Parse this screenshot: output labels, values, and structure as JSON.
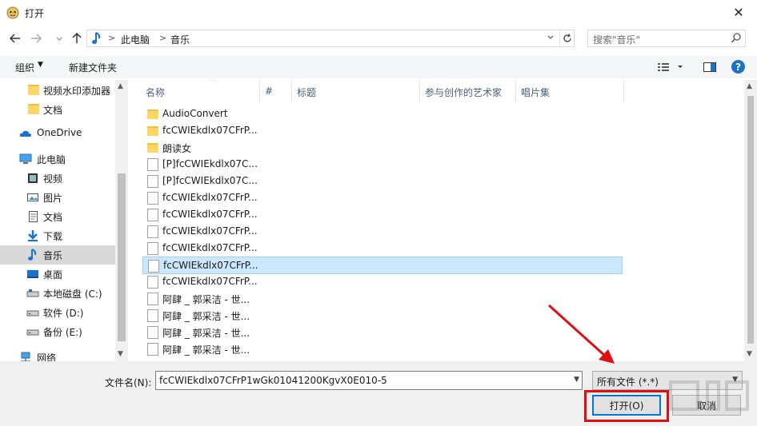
{
  "window": {
    "title": "打开",
    "close_symbol": "✕"
  },
  "address": {
    "crumbs": [
      "此电脑",
      "音乐"
    ],
    "separator": ">"
  },
  "search": {
    "placeholder": "搜索\"音乐\""
  },
  "toolbar": {
    "organize_label": "组织",
    "new_folder_label": "新建文件夹",
    "help_label": "?"
  },
  "nav": {
    "items": [
      {
        "label": "视频水印添加器",
        "icon": "folder-icon",
        "selected": false
      },
      {
        "label": "文档",
        "icon": "folder-icon",
        "selected": false
      },
      {
        "label": "OneDrive",
        "icon": "onedrive-icon",
        "selected": false
      },
      {
        "label": "此电脑",
        "icon": "computer-icon",
        "selected": false
      },
      {
        "label": "视频",
        "icon": "video-icon",
        "selected": false
      },
      {
        "label": "图片",
        "icon": "pictures-icon",
        "selected": false
      },
      {
        "label": "文档",
        "icon": "documents-icon",
        "selected": false
      },
      {
        "label": "下载",
        "icon": "download-icon",
        "selected": false
      },
      {
        "label": "音乐",
        "icon": "music-icon",
        "selected": true
      },
      {
        "label": "桌面",
        "icon": "desktop-icon",
        "selected": false
      },
      {
        "label": "本地磁盘 (C:)",
        "icon": "drive-icon",
        "selected": false
      },
      {
        "label": "软件 (D:)",
        "icon": "drive-icon",
        "selected": false
      },
      {
        "label": "备份 (E:)",
        "icon": "drive-icon",
        "selected": false
      },
      {
        "label": "网络",
        "icon": "network-icon",
        "selected": false
      }
    ]
  },
  "columns": [
    "名称",
    "#",
    "标题",
    "参与创作的艺术家",
    "唱片集"
  ],
  "files": [
    {
      "name": "AudioConvert",
      "type": "folder",
      "selected": false
    },
    {
      "name": "fcCWIEkdlx07CFrP...",
      "type": "folder",
      "selected": false
    },
    {
      "name": "朗读女",
      "type": "folder",
      "selected": false
    },
    {
      "name": "[P]fcCWIEkdlx07C...",
      "type": "file",
      "selected": false
    },
    {
      "name": "[P]fcCWIEkdlx07C...",
      "type": "file",
      "selected": false
    },
    {
      "name": "fcCWIEkdlx07CFrP...",
      "type": "file",
      "selected": false
    },
    {
      "name": "fcCWIEkdlx07CFrP...",
      "type": "file",
      "selected": false
    },
    {
      "name": "fcCWIEkdlx07CFrP...",
      "type": "file",
      "selected": false
    },
    {
      "name": "fcCWIEkdlx07CFrP...",
      "type": "file",
      "selected": false
    },
    {
      "name": "fcCWIEkdlx07CFrP...",
      "type": "file",
      "selected": true
    },
    {
      "name": "fcCWIEkdlx07CFrP...",
      "type": "wma",
      "selected": false
    },
    {
      "name": "阿肆 _ 郭采洁 - 世...",
      "type": "file",
      "selected": false
    },
    {
      "name": "阿肆 _ 郭采洁 - 世...",
      "type": "file",
      "selected": false
    },
    {
      "name": "阿肆 _ 郭采洁 - 世...",
      "type": "wma",
      "selected": false
    },
    {
      "name": "阿肆 _ 郭采洁 - 世...",
      "type": "file",
      "selected": false
    }
  ],
  "footer": {
    "filename_label": "文件名(N):",
    "filename_value": "fcCWIEkdlx07CFrP1wGk01041200KgvX0E010-5",
    "filter_value": "所有文件 (*.*)",
    "open_label": "打开(O)",
    "cancel_label": "取消"
  },
  "colors": {
    "accent": "#0078d7",
    "selection": "#cce8ff",
    "annotation": "#e01010"
  }
}
